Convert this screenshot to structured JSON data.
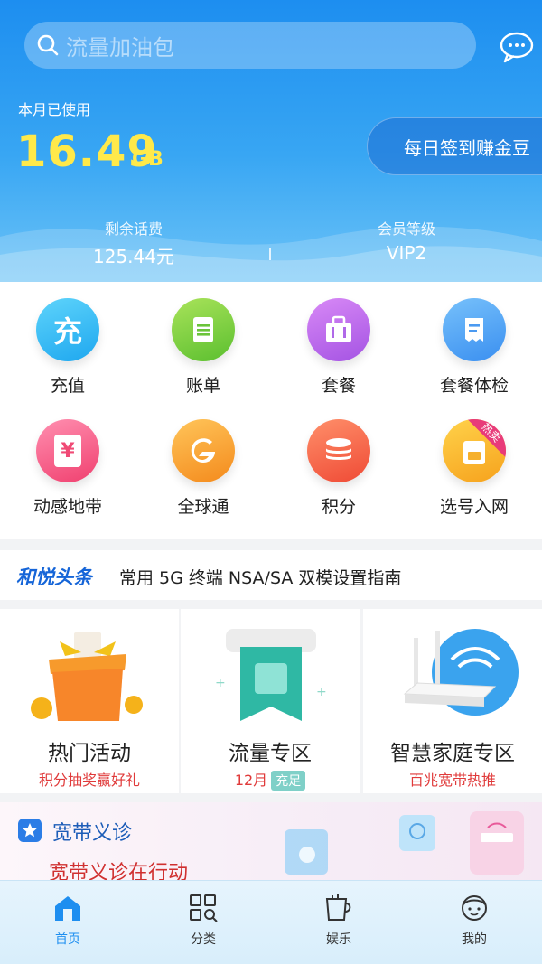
{
  "search": {
    "placeholder": "流量加油包"
  },
  "usage": {
    "label": "本月已使用",
    "value": "16.49",
    "unit": "GB"
  },
  "checkin": {
    "label": "每日签到赚金豆"
  },
  "stats": [
    {
      "label": "剩余话费",
      "value": "125.44元"
    },
    {
      "label": "会员等级",
      "value": "VIP2"
    }
  ],
  "grid": [
    {
      "label": "充值",
      "icon": "recharge-icon",
      "glyph": "充"
    },
    {
      "label": "账单",
      "icon": "bill-icon"
    },
    {
      "label": "套餐",
      "icon": "package-icon"
    },
    {
      "label": "套餐体检",
      "icon": "package-check-icon"
    },
    {
      "label": "动感地带",
      "icon": "mzone-icon",
      "glyph": "¥"
    },
    {
      "label": "全球通",
      "icon": "gotone-icon"
    },
    {
      "label": "积分",
      "icon": "points-icon"
    },
    {
      "label": "选号入网",
      "icon": "select-number-icon",
      "tag": "热卖"
    }
  ],
  "news": {
    "brand": "和悦头条",
    "headline": "常用 5G 终端 NSA/SA 双模设置指南"
  },
  "promos": [
    {
      "title": "热门活动",
      "sub": "积分抽奖赢好礼"
    },
    {
      "title": "流量专区",
      "sub": "12月",
      "badge": "充足"
    },
    {
      "title": "智慧家庭专区",
      "sub": "百兆宽带热推"
    }
  ],
  "banner": {
    "title": "宽带义诊",
    "sub": "宽带义诊在行动"
  },
  "tabs": [
    {
      "label": "首页",
      "icon": "home-icon"
    },
    {
      "label": "分类",
      "icon": "category-icon"
    },
    {
      "label": "娱乐",
      "icon": "cup-icon"
    },
    {
      "label": "我的",
      "icon": "profile-icon"
    }
  ]
}
